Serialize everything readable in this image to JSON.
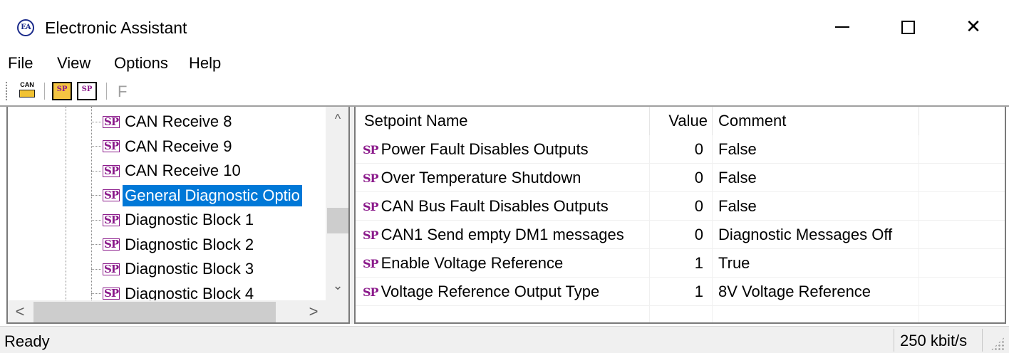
{
  "window": {
    "title": "Electronic Assistant",
    "icon": "electronic-assistant-logo",
    "icon_text": "EA",
    "controls": {
      "minimize": "minimize",
      "maximize": "maximize",
      "close": "✕"
    }
  },
  "menu": {
    "items": [
      "File",
      "View",
      "Options",
      "Help"
    ]
  },
  "toolbar": {
    "can_label": "CAN",
    "open_setpoints_label": "SP",
    "save_setpoints_label": "SP",
    "flash_label": "F"
  },
  "tree": {
    "items": [
      {
        "badge": "SP",
        "label": "CAN Receive 8",
        "selected": false
      },
      {
        "badge": "SP",
        "label": "CAN Receive 9",
        "selected": false
      },
      {
        "badge": "SP",
        "label": "CAN Receive 10",
        "selected": false
      },
      {
        "badge": "SP",
        "label": "General Diagnostic Optio",
        "selected": true
      },
      {
        "badge": "SP",
        "label": "Diagnostic Block 1",
        "selected": false
      },
      {
        "badge": "SP",
        "label": "Diagnostic Block 2",
        "selected": false
      },
      {
        "badge": "SP",
        "label": "Diagnostic Block 3",
        "selected": false
      },
      {
        "badge": "SP",
        "label": "Diagnostic Block 4",
        "selected": false
      }
    ],
    "scroll_up": "^",
    "scroll_down": "⌄",
    "scroll_left": "<",
    "scroll_right": ">"
  },
  "setpoints": {
    "columns": {
      "name": "Setpoint Name",
      "value": "Value",
      "comment": "Comment"
    },
    "rows": [
      {
        "badge": "SP",
        "name": "Power Fault Disables Outputs",
        "value": "0",
        "comment": "False"
      },
      {
        "badge": "SP",
        "name": "Over Temperature Shutdown",
        "value": "0",
        "comment": "False"
      },
      {
        "badge": "SP",
        "name": "CAN Bus Fault Disables Outputs",
        "value": "0",
        "comment": "False"
      },
      {
        "badge": "SP",
        "name": "CAN1 Send empty DM1 messages",
        "value": "0",
        "comment": "Diagnostic Messages Off"
      },
      {
        "badge": "SP",
        "name": "Enable Voltage Reference",
        "value": "1",
        "comment": "True"
      },
      {
        "badge": "SP",
        "name": "Voltage Reference Output Type",
        "value": "1",
        "comment": "8V Voltage Reference"
      }
    ]
  },
  "status": {
    "left": "Ready",
    "right": "250 kbit/s"
  },
  "colors": {
    "selection": "#0078d7",
    "sp_badge": "#8b1a8b"
  }
}
